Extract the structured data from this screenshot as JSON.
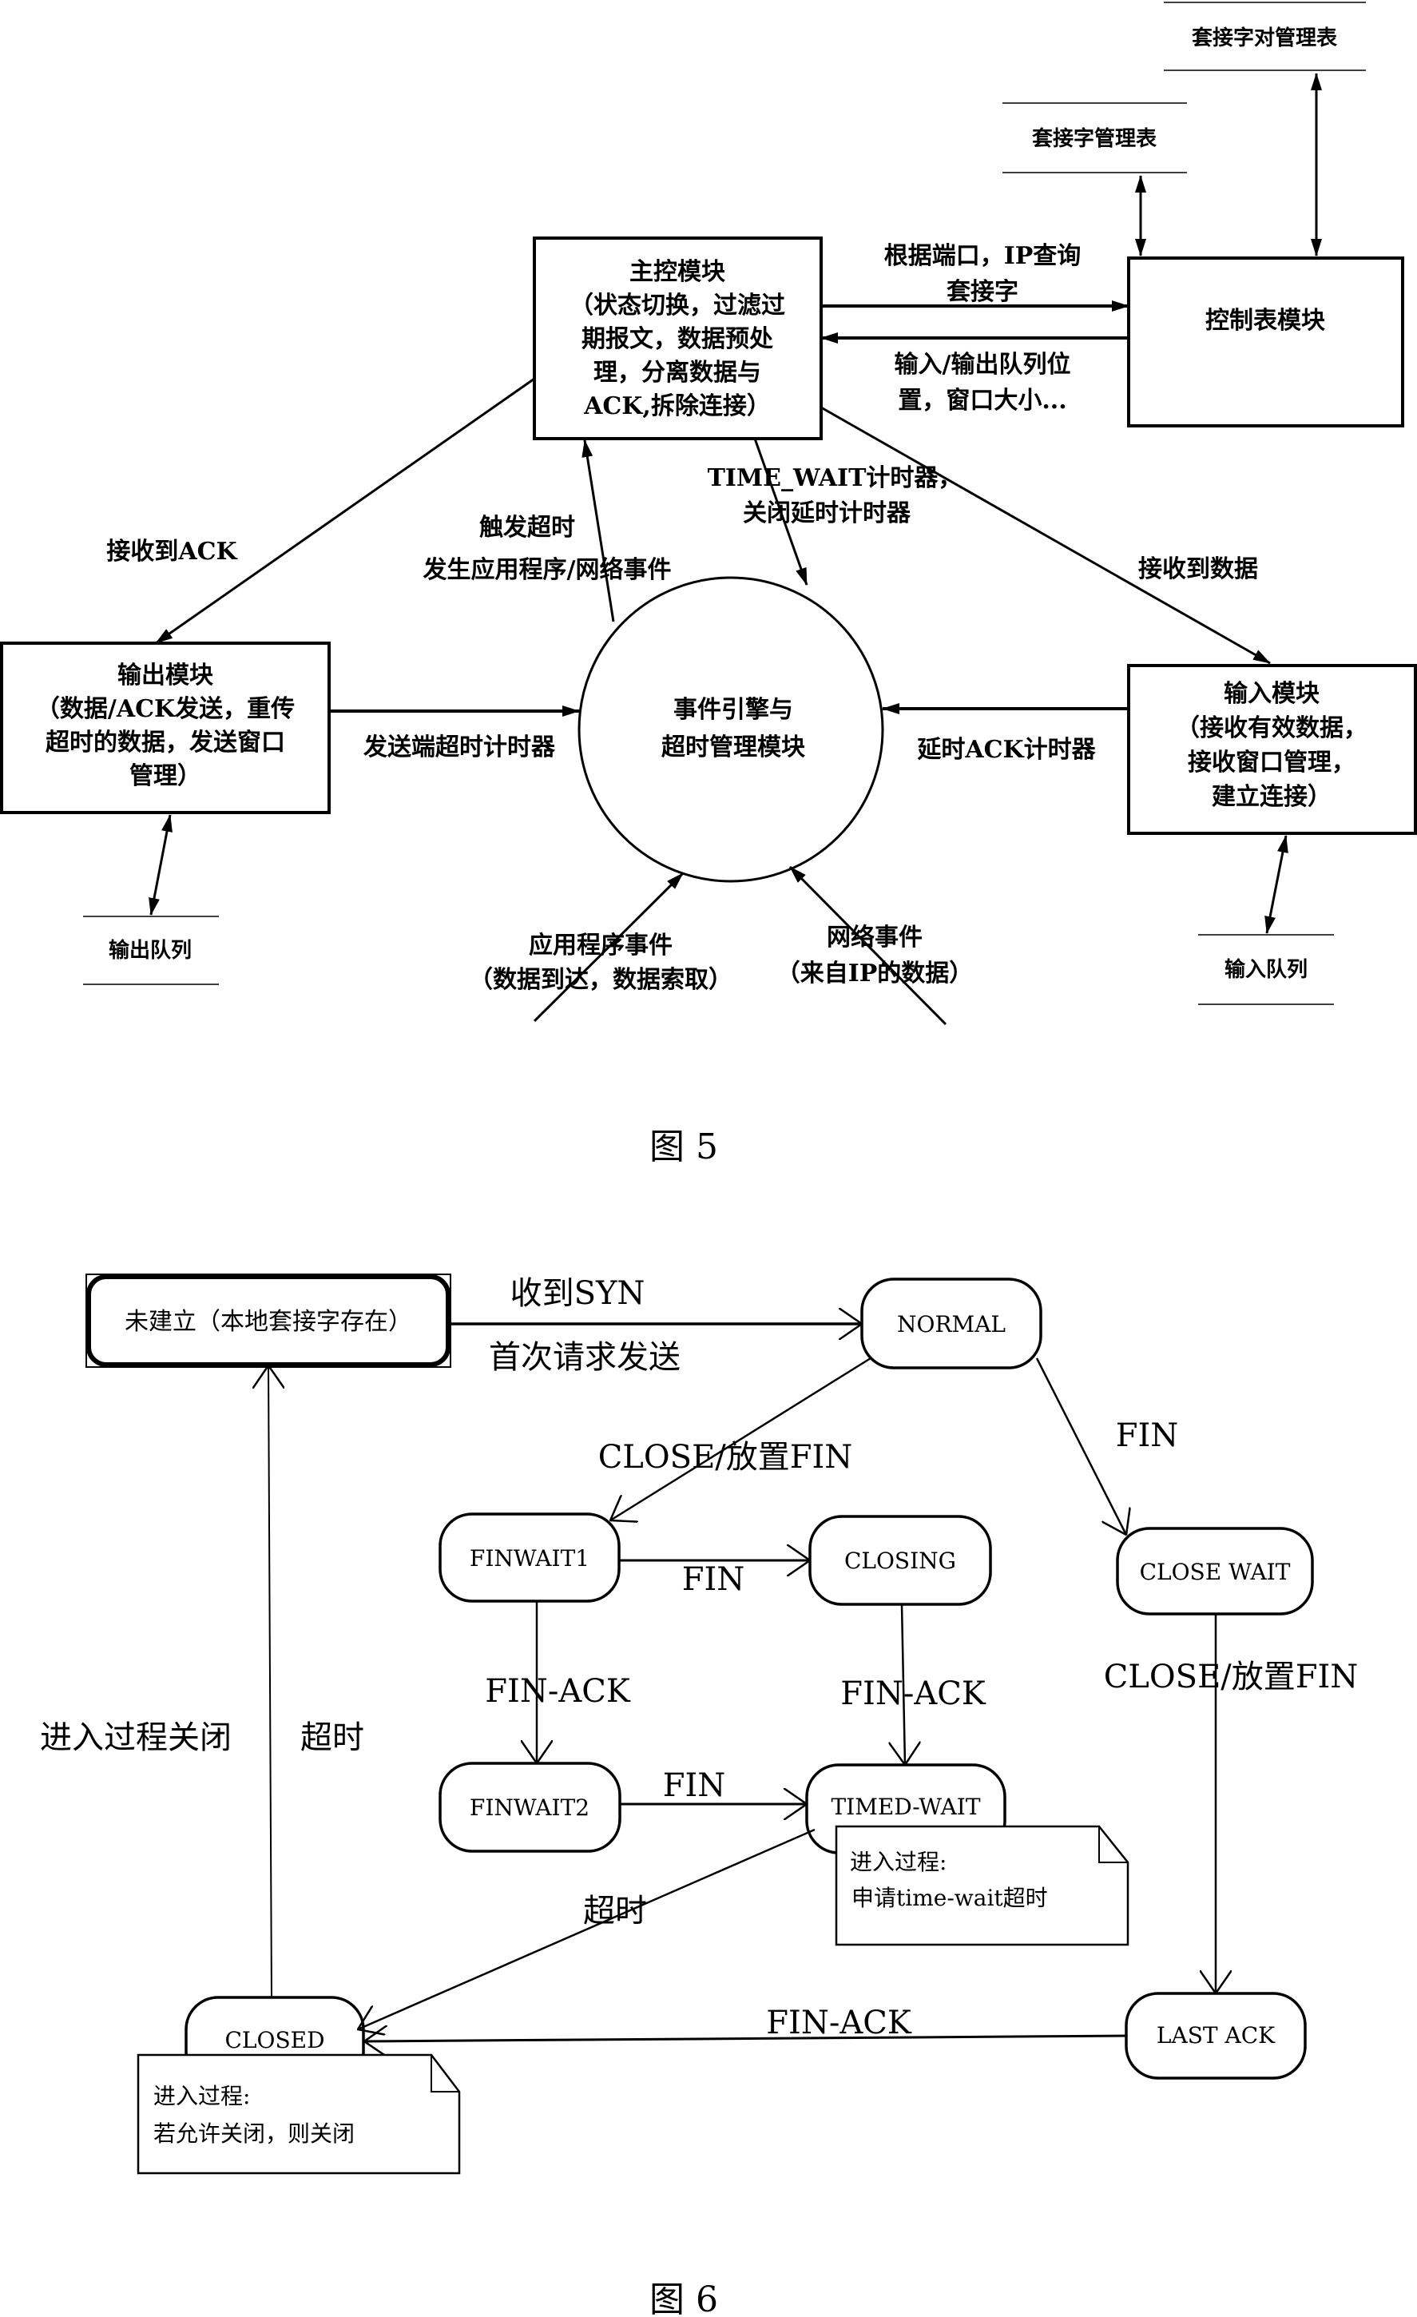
{
  "figure5": {
    "caption": "图 5",
    "modules": {
      "main_control": {
        "title": "主控模块",
        "lines": [
          "（状态切换，过滤过",
          "期报文，数据预处",
          "理，分离数据与",
          "ACK,拆除连接）"
        ]
      },
      "control_table": {
        "title": "控制表模块"
      },
      "output": {
        "title": "输出模块",
        "lines": [
          "（数据/ACK发送，重传",
          "超时的数据，发送窗口",
          "管理）"
        ]
      },
      "input": {
        "title": "输入模块",
        "lines": [
          "（接收有效数据，",
          "接收窗口管理，",
          "建立连接）"
        ]
      },
      "event_engine": {
        "lines": [
          "事件引擎与",
          "超时管理模块"
        ]
      }
    },
    "stores": {
      "socket_pair_table": "套接字对管理表",
      "socket_table": "套接字管理表",
      "output_queue": "输出队列",
      "input_queue": "输入队列"
    },
    "edge_labels": {
      "query_socket": [
        "根据端口，IP查询",
        "套接字"
      ],
      "queue_window": [
        "输入/输出队列位",
        "置，窗口大小..."
      ],
      "ack_received": "接收到ACK",
      "data_received": "接收到数据",
      "trigger_timeout": [
        "触发超时",
        "发生应用程序/网络事件"
      ],
      "time_wait_timer": [
        "TIME_WAIT计时器，",
        "关闭延时计时器"
      ],
      "send_timer": "发送端超时计时器",
      "delayed_ack_timer": "延时ACK计时器",
      "app_event": [
        "应用程序事件",
        "（数据到达，数据索取）"
      ],
      "net_event": [
        "网络事件",
        "（来自IP的数据）"
      ]
    }
  },
  "figure6": {
    "caption": "图 6",
    "states": {
      "not_established": "未建立（本地套接字存在）",
      "normal": "NORMAL",
      "finwait1": "FINWAIT1",
      "closing": "CLOSING",
      "close_wait": "CLOSE WAIT",
      "finwait2": "FINWAIT2",
      "timed_wait": "TIMED-WAIT",
      "closed": "CLOSED",
      "last_ack": "LAST ACK"
    },
    "transitions": {
      "syn_received": "收到SYN",
      "first_request": "首次请求发送",
      "close_set_fin_1": "CLOSE/放置FIN",
      "fin_normal": "FIN",
      "fin_fw1": "FIN",
      "finack_fw1": "FIN-ACK",
      "finack_closing": "FIN-ACK",
      "close_set_fin_2": "CLOSE/放置FIN",
      "fin_fw2": "FIN",
      "timeout_tw": "超时",
      "finack_last": "FIN-ACK",
      "enter_close": "进入过程关闭",
      "timeout_closed": "超时"
    },
    "notes": {
      "timed_wait": [
        "进入过程:",
        "申请time-wait超时"
      ],
      "closed": [
        "进入过程:",
        "若允许关闭，则关闭"
      ]
    }
  }
}
